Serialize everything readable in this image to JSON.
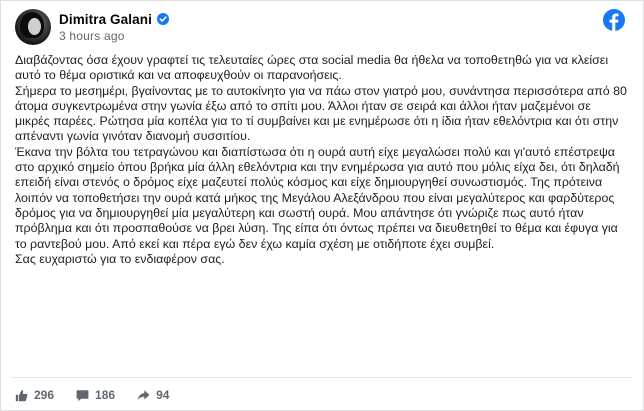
{
  "post": {
    "author": "Dimitra Galani",
    "timestamp": "3 hours ago",
    "paragraphs": [
      "Διαβάζοντας όσα έχουν γραφτεί τις τελευταίες ώρες στα social media θα ήθελα να τοποθετηθώ για να κλείσει αυτό το θέμα οριστικά και να αποφευχθούν οι παρανοήσεις.",
      "Σήμερα το μεσημέρι, βγαίνοντας με το αυτοκίνητο για να πάω στον γιατρό μου, συνάντησα περισσότερα από 80 άτομα συγκεντρωμένα στην γωνία έξω από το σπίτι μου. Άλλοι ήταν σε σειρά και άλλοι ήταν μαζεμένοι σε μικρές παρέες. Ρώτησα μία κοπέλα για το τί συμβαίνει και με ενημέρωσε ότι η ίδια ήταν εθελόντρια και ότι στην απέναντι γωνία γινόταν διανομή συσσιτίου.",
      "Έκανα την βόλτα του τετραγώνου και διαπίστωσα ότι η ουρά αυτή είχε μεγαλώσει πολύ και γι'αυτό επέστρεψα στο αρχικό σημείο όπου βρήκα μία άλλη εθελόντρια και την ενημέρωσα για αυτό που μόλις είχα δει, ότι δηλαδή επειδή είναι στενός ο δρόμος είχε μαζευτεί πολύς κόσμος και είχε δημιουργηθεί συνωστισμός. Της πρότεινα λοιπόν να τοποθετήσει την ουρά κατά μήκος της Μεγάλου Αλεξάνδρου που είναι μεγαλύτερος και φαρδύτερος δρόμος για να δημιουργηθεί μία μεγαλύτερη και σωστή ουρά. Μου απάντησε ότι γνώριζε πως αυτό ήταν πρόβλημα και ότι προσπαθούσε να βρει λύση. Της είπα ότι όντως πρέπει να διευθετηθεί το θέμα και έφυγα για το ραντεβού μου. Από εκεί και πέρα εγώ δεν έχω καμία σχέση με οτιδήποτε έχει συμβεί.",
      "Σας ευχαριστώ για το ενδιαφέρον σας."
    ]
  },
  "engagement": {
    "likes": "296",
    "comments": "186",
    "shares": "94"
  },
  "icons": {
    "verified": "verified-badge-icon",
    "facebook": "facebook-logo-icon",
    "like": "thumbs-up-icon",
    "comment": "comment-icon",
    "share": "share-arrow-icon"
  },
  "colors": {
    "facebook_blue": "#1877f2",
    "text": "#1c1e21",
    "secondary_text": "#65676b",
    "icon_gray": "#606770"
  }
}
